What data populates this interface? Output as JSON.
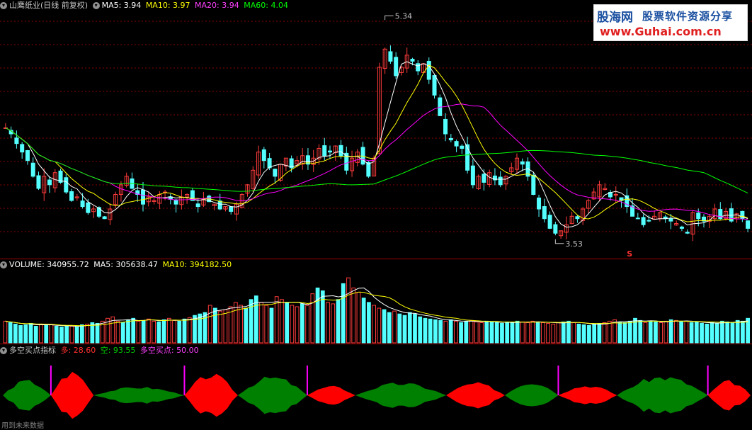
{
  "main_header": {
    "title": "山鹰纸业(日线 前复权)",
    "ma5": "MA5: 3.94",
    "ma10": "MA10: 3.97",
    "ma20": "MA20: 3.94",
    "ma60": "MA60: 4.04"
  },
  "volume_header": {
    "volume": "VOLUME: 340955.72",
    "ma5": "MA5: 305638.47",
    "ma10": "MA10: 394182.50"
  },
  "indicator_header": {
    "name": "多空买点指标",
    "duo": "多: 28.60",
    "kong": "空: 93.55",
    "buy_point": "多空买点: 50.00"
  },
  "annotations": {
    "high": "5.34",
    "low": "3.53",
    "signal": "S"
  },
  "watermark": {
    "site_cn": "股海网",
    "slogan": "股票软件资源分享",
    "url": "www.Guhai.com.cn"
  },
  "footer": "用到未来数据",
  "colors": {
    "up": "#ff3c3c",
    "down": "#54ffff",
    "ma5": "#ffffff",
    "ma10": "#ffff00",
    "ma20": "#ff00ff",
    "ma60": "#00ff00",
    "duo_fill": "#ff0000",
    "kong_fill": "#008000",
    "buy_line": "#ff00ff"
  },
  "chart_data": [
    {
      "type": "candlestick",
      "title": "山鹰纸业(日线 前复权)",
      "series": [
        {
          "name": "MA5",
          "last": 3.94
        },
        {
          "name": "MA10",
          "last": 3.97
        },
        {
          "name": "MA20",
          "last": 3.94
        },
        {
          "name": "MA60",
          "last": 4.04
        }
      ],
      "close_path": [
        4.45,
        4.4,
        4.32,
        4.25,
        4.18,
        4.05,
        3.95,
        4.05,
        3.98,
        4.08,
        4.0,
        3.92,
        3.85,
        3.88,
        3.8,
        3.75,
        3.78,
        3.72,
        3.7,
        3.78,
        3.9,
        3.98,
        4.05,
        3.95,
        3.9,
        3.82,
        3.88,
        3.85,
        3.9,
        3.92,
        3.86,
        3.82,
        3.88,
        3.9,
        3.85,
        3.8,
        3.86,
        3.84,
        3.82,
        3.78,
        3.8,
        3.76,
        3.82,
        3.9,
        3.98,
        4.1,
        4.25,
        4.18,
        4.12,
        4.05,
        4.15,
        4.2,
        4.12,
        4.18,
        4.22,
        4.15,
        4.2,
        4.28,
        4.22,
        4.25,
        4.3,
        4.22,
        4.1,
        4.2,
        4.25,
        4.15,
        4.05,
        4.2,
        4.95,
        5.1,
        5.0,
        4.88,
        4.95,
        5.05,
        5.0,
        4.92,
        4.98,
        4.85,
        4.72,
        4.55,
        4.4,
        4.35,
        4.3,
        4.28,
        4.1,
        3.98,
        4.05,
        4.0,
        4.08,
        4.02,
        3.98,
        4.05,
        4.12,
        4.2,
        4.15,
        4.05,
        3.9,
        3.78,
        3.7,
        3.62,
        3.58,
        3.6,
        3.65,
        3.72,
        3.7,
        3.78,
        3.85,
        3.92,
        3.98,
        3.95,
        3.88,
        3.9,
        3.85,
        3.8,
        3.72,
        3.7,
        3.65,
        3.68,
        3.72,
        3.75,
        3.7,
        3.68,
        3.66,
        3.62,
        3.58,
        3.75,
        3.7,
        3.68,
        3.72,
        3.78,
        3.7,
        3.76,
        3.68,
        3.74,
        3.7,
        3.62
      ],
      "annotations": [
        {
          "label": "5.34",
          "kind": "high"
        },
        {
          "label": "3.53",
          "kind": "low"
        },
        {
          "label": "S",
          "kind": "signal"
        }
      ],
      "ylim": [
        3.4,
        5.4
      ]
    },
    {
      "type": "bar",
      "title": "VOLUME",
      "series": [
        {
          "name": "VOLUME",
          "last": 340955.72
        },
        {
          "name": "MA5",
          "last": 305638.47
        },
        {
          "name": "MA10",
          "last": 394182.5
        }
      ],
      "values_k": [
        300,
        280,
        260,
        240,
        250,
        270,
        230,
        260,
        240,
        250,
        230,
        220,
        240,
        230,
        220,
        250,
        260,
        280,
        270,
        300,
        340,
        360,
        300,
        280,
        320,
        340,
        300,
        310,
        330,
        300,
        290,
        320,
        340,
        310,
        300,
        330,
        350,
        380,
        400,
        420,
        520,
        480,
        440,
        460,
        500,
        560,
        520,
        480,
        600,
        650,
        560,
        520,
        480,
        640,
        600,
        560,
        520,
        500,
        540,
        520,
        680,
        760,
        720,
        560,
        540,
        600,
        820,
        900,
        760,
        700,
        620,
        560,
        520,
        480,
        460,
        420,
        440,
        400,
        380,
        420,
        400,
        360,
        340,
        330,
        320,
        310,
        300,
        320,
        300,
        280,
        300,
        310,
        290,
        280,
        300,
        290,
        280,
        270,
        290,
        280,
        300,
        290,
        280,
        300,
        290,
        280,
        270,
        260,
        280,
        290,
        300,
        280,
        260,
        250,
        240,
        260,
        270,
        280,
        300,
        320,
        290,
        280,
        300,
        340,
        310,
        280,
        300,
        290,
        280,
        300,
        320,
        310,
        290,
        300,
        280,
        290,
        270,
        260,
        280,
        270,
        300,
        290,
        280,
        310,
        300,
        340
      ],
      "ylim": [
        0,
        1000
      ]
    },
    {
      "type": "area",
      "title": "多空买点指标",
      "series": [
        {
          "name": "多",
          "last": 28.6
        },
        {
          "name": "空",
          "last": 93.55
        },
        {
          "name": "多空买点",
          "last": 50.0
        }
      ],
      "ylim": [
        0,
        100
      ]
    }
  ]
}
